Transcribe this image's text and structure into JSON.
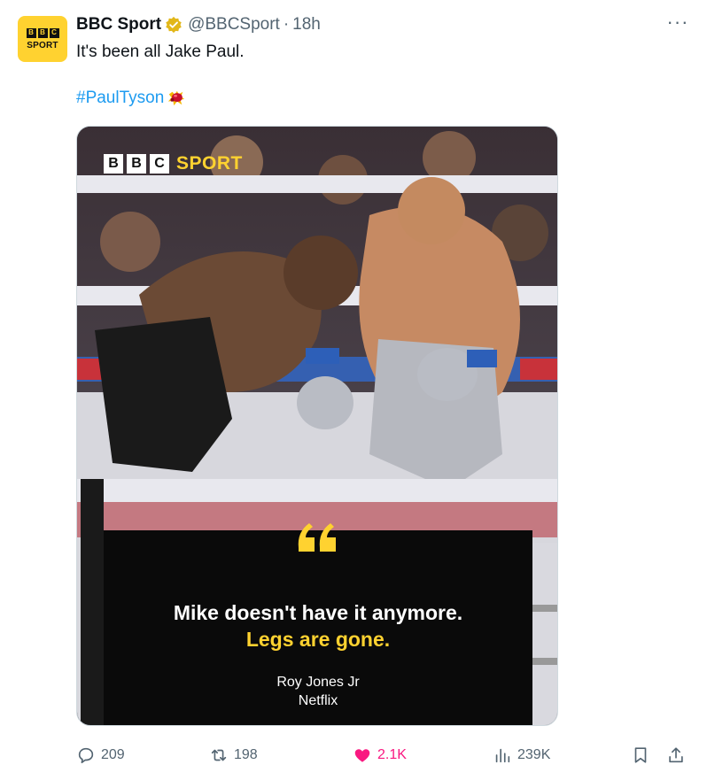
{
  "author": {
    "name": "BBC Sport",
    "handle": "@BBCSport",
    "separator": "·",
    "time": "18h",
    "avatar_blocks": [
      "B",
      "B",
      "C"
    ],
    "avatar_word": "SPORT"
  },
  "tweet": {
    "text": "It's been all Jake Paul.",
    "hashtag": "#PaulTyson",
    "hashtag_emoji": "boxing-glove-icon"
  },
  "menu": {
    "more_label": "···"
  },
  "media": {
    "logo_blocks": [
      "B",
      "B",
      "C"
    ],
    "logo_word": "SPORT",
    "quote_line1": "Mike doesn't have it anymore.",
    "quote_line2": "Legs are gone.",
    "attribution_name": "Roy Jones Jr",
    "attribution_source": "Netflix"
  },
  "actions": {
    "replies": "209",
    "reposts": "198",
    "likes": "2.1K",
    "views": "239K"
  },
  "colors": {
    "accent": "#1d9bf0",
    "like": "#f91880",
    "muted": "#536471",
    "bbc_yellow": "#ffd230",
    "verified_gold": "#e2b719"
  }
}
